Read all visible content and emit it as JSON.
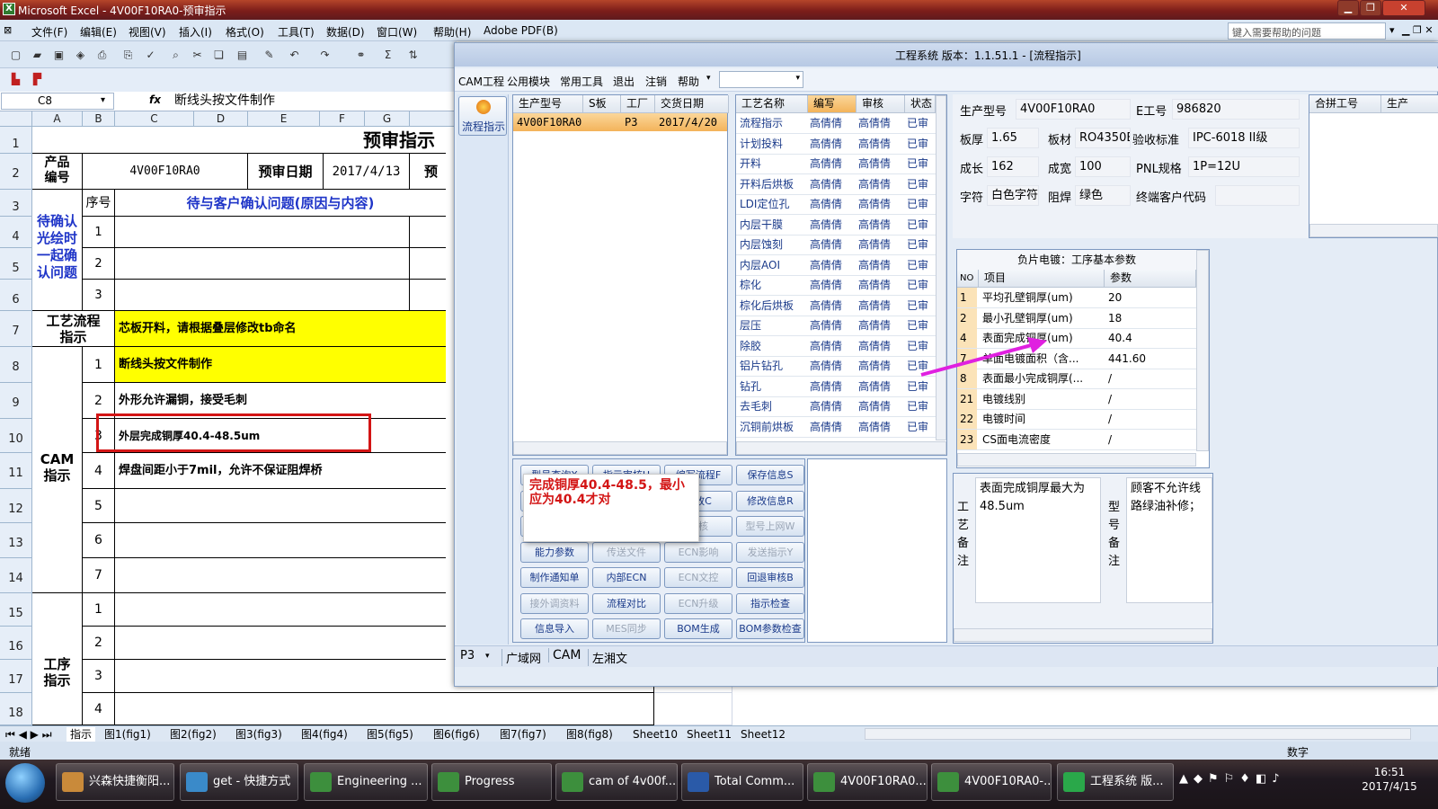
{
  "excel": {
    "title": "Microsoft Excel - 4V00F10RA0-预审指示",
    "menu": [
      "文件(F)",
      "编辑(E)",
      "视图(V)",
      "插入(I)",
      "格式(O)",
      "工具(T)",
      "数据(D)",
      "窗口(W)",
      "帮助(H)",
      "Adobe PDF(B)"
    ],
    "help_placeholder": "键入需要帮助的问题",
    "name_box": "C8",
    "fx": "fx",
    "formula": "断线头按文件制作",
    "columns": [
      "A",
      "B",
      "C",
      "D",
      "E",
      "F",
      "G"
    ],
    "rows": [
      "1",
      "2",
      "3",
      "4",
      "5",
      "6",
      "7",
      "8",
      "9",
      "10",
      "11",
      "12",
      "13",
      "14",
      "15",
      "16",
      "17",
      "18"
    ],
    "sheet_title": "预审指示",
    "product_label": "产品\n编号",
    "product_no": "4V00F10RA0",
    "review_date_label": "预审日期",
    "review_date": "2017/4/13",
    "review_cut": "预审",
    "seq_label": "序号",
    "confirm_header": "待与客户确认问题(原因与内容)",
    "pending_label": "待确认\n光绘时\n一起确\n认问题",
    "flow_label": "工艺流程\n指示",
    "flow_text": "芯板开料，请根据叠层修改tb命名",
    "cam_label": "CAM\n指示",
    "cam_items": [
      {
        "no": "1",
        "text": "断线头按文件制作"
      },
      {
        "no": "2",
        "text": "外形允许漏铜，接受毛刺"
      },
      {
        "no": "3",
        "text": "外层完成铜厚40.4-48.5um"
      },
      {
        "no": "4",
        "text": "焊盘间距小于7mil，允许不保证阻焊桥"
      },
      {
        "no": "5",
        "text": ""
      },
      {
        "no": "6",
        "text": ""
      },
      {
        "no": "7",
        "text": ""
      }
    ],
    "process_label": "工序\n指示",
    "process_nos": [
      "1",
      "2",
      "3",
      "4"
    ],
    "pending_nos": [
      "1",
      "2",
      "3"
    ],
    "sheet_tabs": [
      "指示",
      "图1(fig1)",
      "图2(fig2)",
      "图3(fig3)",
      "图4(fig4)",
      "图5(fig5)",
      "图6(fig6)",
      "图7(fig7)",
      "图8(fig8)",
      "Sheet10",
      "Sheet11",
      "Sheet12"
    ],
    "status_left": "就绪",
    "status_right": "数字"
  },
  "eng": {
    "title": "工程系统  版本：1.1.51.1 - [流程指示]",
    "menu": [
      "CAM工程",
      "公用模块",
      "常用工具",
      "退出",
      "注销",
      "帮助"
    ],
    "side_button": "流程指示",
    "orders_headers": [
      "生产型号",
      "S板",
      "工厂",
      "交货日期"
    ],
    "orders": [
      {
        "model": "4V00F10RA0",
        "s": "",
        "factory": "P3",
        "date": "2017/4/20"
      }
    ],
    "process_headers": [
      "工艺名称",
      "编写",
      "审核",
      "状态"
    ],
    "processes": [
      {
        "name": "流程指示",
        "w": "高倩倩",
        "r": "高倩倩",
        "s": "已审"
      },
      {
        "name": "计划投料",
        "w": "高倩倩",
        "r": "高倩倩",
        "s": "已审"
      },
      {
        "name": "开料",
        "w": "高倩倩",
        "r": "高倩倩",
        "s": "已审"
      },
      {
        "name": "开料后烘板",
        "w": "高倩倩",
        "r": "高倩倩",
        "s": "已审"
      },
      {
        "name": "LDI定位孔",
        "w": "高倩倩",
        "r": "高倩倩",
        "s": "已审"
      },
      {
        "name": "内层干膜",
        "w": "高倩倩",
        "r": "高倩倩",
        "s": "已审"
      },
      {
        "name": "内层蚀刻",
        "w": "高倩倩",
        "r": "高倩倩",
        "s": "已审"
      },
      {
        "name": "内层AOI",
        "w": "高倩倩",
        "r": "高倩倩",
        "s": "已审"
      },
      {
        "name": "棕化",
        "w": "高倩倩",
        "r": "高倩倩",
        "s": "已审"
      },
      {
        "name": "棕化后烘板",
        "w": "高倩倩",
        "r": "高倩倩",
        "s": "已审"
      },
      {
        "name": "层压",
        "w": "高倩倩",
        "r": "高倩倩",
        "s": "已审"
      },
      {
        "name": "除胶",
        "w": "高倩倩",
        "r": "高倩倩",
        "s": "已审"
      },
      {
        "name": "铝片钻孔",
        "w": "高倩倩",
        "r": "高倩倩",
        "s": "已审"
      },
      {
        "name": "钻孔",
        "w": "高倩倩",
        "r": "高倩倩",
        "s": "已审"
      },
      {
        "name": "去毛刺",
        "w": "高倩倩",
        "r": "高倩倩",
        "s": "已审"
      },
      {
        "name": "沉铜前烘板",
        "w": "高倩倩",
        "r": "高倩倩",
        "s": "已审"
      }
    ],
    "buttons": [
      {
        "label": "型号查询X",
        "dis": false
      },
      {
        "label": "指示审核H",
        "dis": false
      },
      {
        "label": "编写流程F",
        "dis": false
      },
      {
        "label": "保存信息S",
        "dis": false
      },
      {
        "label": "",
        "dis": false
      },
      {
        "label": "",
        "dis": false
      },
      {
        "label": "修改C",
        "dis": false
      },
      {
        "label": "修改信息R",
        "dis": false
      },
      {
        "label": "",
        "dis": true
      },
      {
        "label": "",
        "dis": true
      },
      {
        "label": "审核",
        "dis": true
      },
      {
        "label": "型号上网W",
        "dis": true
      },
      {
        "label": "能力参数",
        "dis": false
      },
      {
        "label": "传送文件",
        "dis": true
      },
      {
        "label": "ECN影响",
        "dis": true
      },
      {
        "label": "发送指示Y",
        "dis": true
      },
      {
        "label": "制作通知单",
        "dis": false
      },
      {
        "label": "内部ECN",
        "dis": false
      },
      {
        "label": "ECN文控",
        "dis": true
      },
      {
        "label": "回退审核B",
        "dis": false
      },
      {
        "label": "接外调资料",
        "dis": true
      },
      {
        "label": "流程对比",
        "dis": false
      },
      {
        "label": "ECN升级",
        "dis": true
      },
      {
        "label": "指示检查",
        "dis": false
      },
      {
        "label": "信息导入",
        "dis": false
      },
      {
        "label": "MES同步",
        "dis": true
      },
      {
        "label": "BOM生成",
        "dis": false
      },
      {
        "label": "BOM参数检查",
        "dis": false
      }
    ],
    "popup_text": "完成铜厚40.4-48.5，最小应为40.4才对",
    "info": {
      "model_label": "生产型号",
      "model": "4V00F10RA0",
      "eno_label": "E工号",
      "eno": "986820",
      "thick_label": "板厚",
      "thick": "1.65",
      "material_label": "板材",
      "material": "RO4350B",
      "accept_label": "验收标准",
      "accept": "IPC-6018 II级",
      "len_label": "成长",
      "len": "162",
      "wid_label": "成宽",
      "wid": "100",
      "pnl_label": "PNL规格",
      "pnl": "1P=12U",
      "char_label": "字符",
      "char": "白色字符",
      "mask_label": "阻焊",
      "mask": "绿色",
      "cust_label": "终端客户代码",
      "cust": ""
    },
    "merge_headers": [
      "合拼工号",
      "生产"
    ],
    "param_title": "负片电镀：工序基本参数",
    "param_headers": [
      "NO",
      "项目",
      "参数"
    ],
    "params": [
      {
        "no": "1",
        "item": "平均孔壁铜厚(um)",
        "val": "20"
      },
      {
        "no": "2",
        "item": "最小孔壁铜厚(um)",
        "val": "18"
      },
      {
        "no": "4",
        "item": "表面完成铜厚(um)",
        "val": "40.4"
      },
      {
        "no": "7",
        "item": "单面电镀面积（含...",
        "val": "441.60"
      },
      {
        "no": "8",
        "item": "表面最小完成铜厚(...",
        "val": "/"
      },
      {
        "no": "21",
        "item": "电镀线别",
        "val": "/"
      },
      {
        "no": "22",
        "item": "电镀时间",
        "val": "/"
      },
      {
        "no": "23",
        "item": "CS面电流密度",
        "val": "/"
      }
    ],
    "craft_note_label": "工艺备注",
    "craft_note": "表面完成铜厚最大为48.5um",
    "model_note_label": "型号备注",
    "model_note": "顾客不允许线路绿油补修；",
    "status": [
      "P3",
      "广域网",
      "CAM",
      "左湘文"
    ]
  },
  "taskbar": {
    "items": [
      "兴森快捷衡阳...",
      "get - 快捷方式",
      "Engineering ...",
      "Progress",
      "cam of 4v00f...",
      "Total Comm...",
      "4V00F10RA0...",
      "4V00F10RA0-...",
      "工程系统  版..."
    ],
    "time": "16:51",
    "date": "2017/4/15"
  },
  "colors": {
    "highlight_yellow": "#ffff00",
    "annot_red": "#d31515",
    "arrow_magenta": "#e020e0",
    "title_blue": "#1f35c8"
  }
}
